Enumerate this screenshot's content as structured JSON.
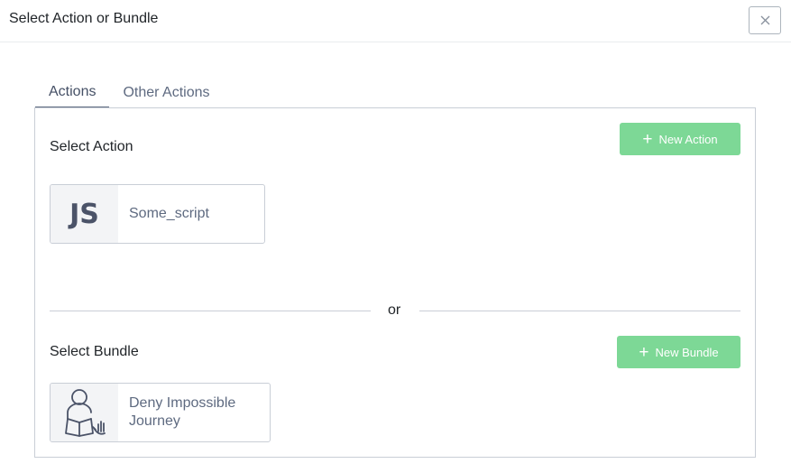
{
  "modal": {
    "title": "Select Action or Bundle",
    "close_icon": "close-icon"
  },
  "tabs": [
    {
      "label": "Actions",
      "active": true
    },
    {
      "label": "Other Actions",
      "active": false
    }
  ],
  "actions_section": {
    "title": "Select Action",
    "new_button_label": "New Action",
    "items": [
      {
        "icon": "js-icon",
        "icon_text": "JS",
        "label": "Some_script"
      }
    ]
  },
  "divider": {
    "text": "or"
  },
  "bundles_section": {
    "title": "Select Bundle",
    "new_button_label": "New Bundle",
    "items": [
      {
        "icon": "person-reading-hand-icon",
        "label": "Deny Impossible Journey"
      }
    ]
  },
  "colors": {
    "accent_green": "#7dd896",
    "text_muted": "#5e6a80",
    "border": "#c9ced6"
  }
}
